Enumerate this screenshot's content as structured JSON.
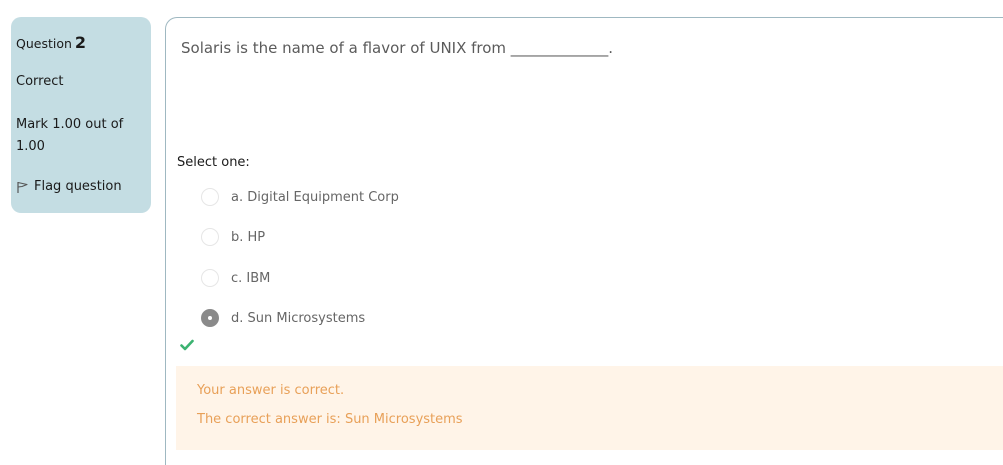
{
  "info": {
    "question_label": "Question",
    "question_number": "2",
    "state": "Correct",
    "grade": "Mark 1.00 out of 1.00",
    "flag_label": "Flag question"
  },
  "question": {
    "text": "Solaris is the name of a flavor of UNIX from _____________.",
    "prompt": "Select one:",
    "options": [
      {
        "label": "a. Digital Equipment Corp",
        "selected": false
      },
      {
        "label": "b. HP",
        "selected": false
      },
      {
        "label": "c. IBM",
        "selected": false
      },
      {
        "label": "d. Sun Microsystems",
        "selected": true
      }
    ]
  },
  "feedback": {
    "result": "Your answer is correct.",
    "correct_answer": "The correct answer is: Sun Microsystems"
  },
  "icons": {
    "flag": "flag-icon",
    "correct": "check-icon"
  },
  "colors": {
    "info_panel": "#c4dde3",
    "feedback_bg": "#fff4e8",
    "feedback_text": "#e8a058",
    "check": "#3cb371"
  }
}
